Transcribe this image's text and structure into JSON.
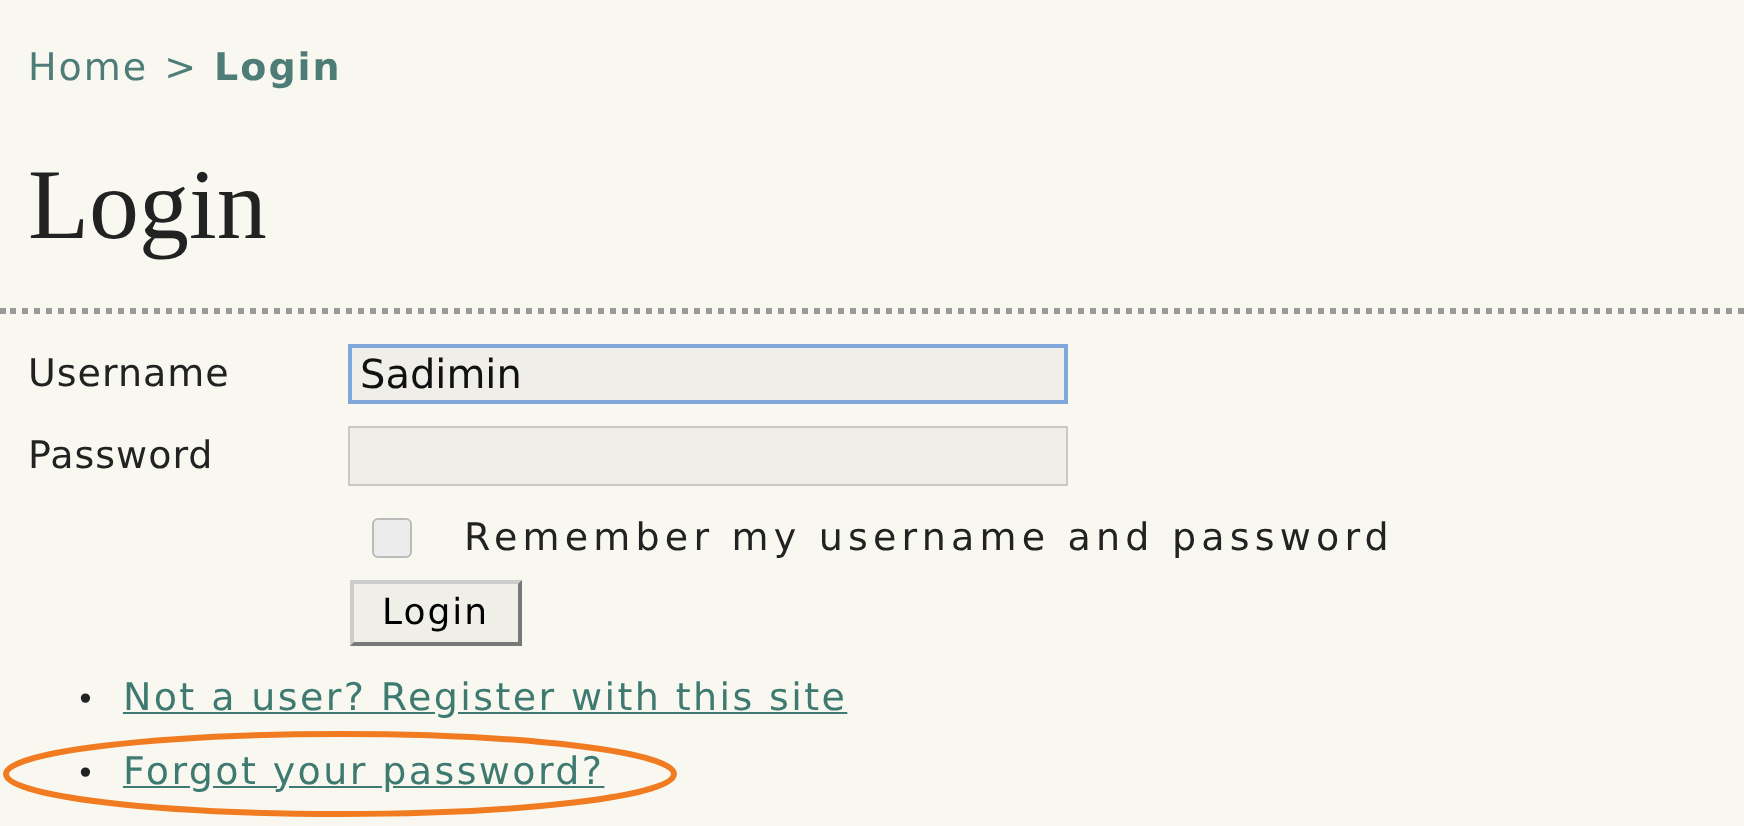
{
  "breadcrumb": {
    "separator": ">",
    "items": [
      {
        "label": "Home",
        "current": false
      },
      {
        "label": "Login",
        "current": true
      }
    ]
  },
  "heading": "Login",
  "fields": [
    {
      "label": "Username",
      "value": "Sadimin",
      "focused": true
    },
    {
      "label": "Password",
      "focused": false
    }
  ],
  "remember": {
    "label": "Remember my username and password",
    "checked": false
  },
  "submit": "Login",
  "links": [
    {
      "marker": "•",
      "text": "Not a user? Register with this site",
      "highlighted": false
    },
    {
      "marker": "•",
      "text": "Forgot your password?",
      "highlighted": true
    }
  ]
}
